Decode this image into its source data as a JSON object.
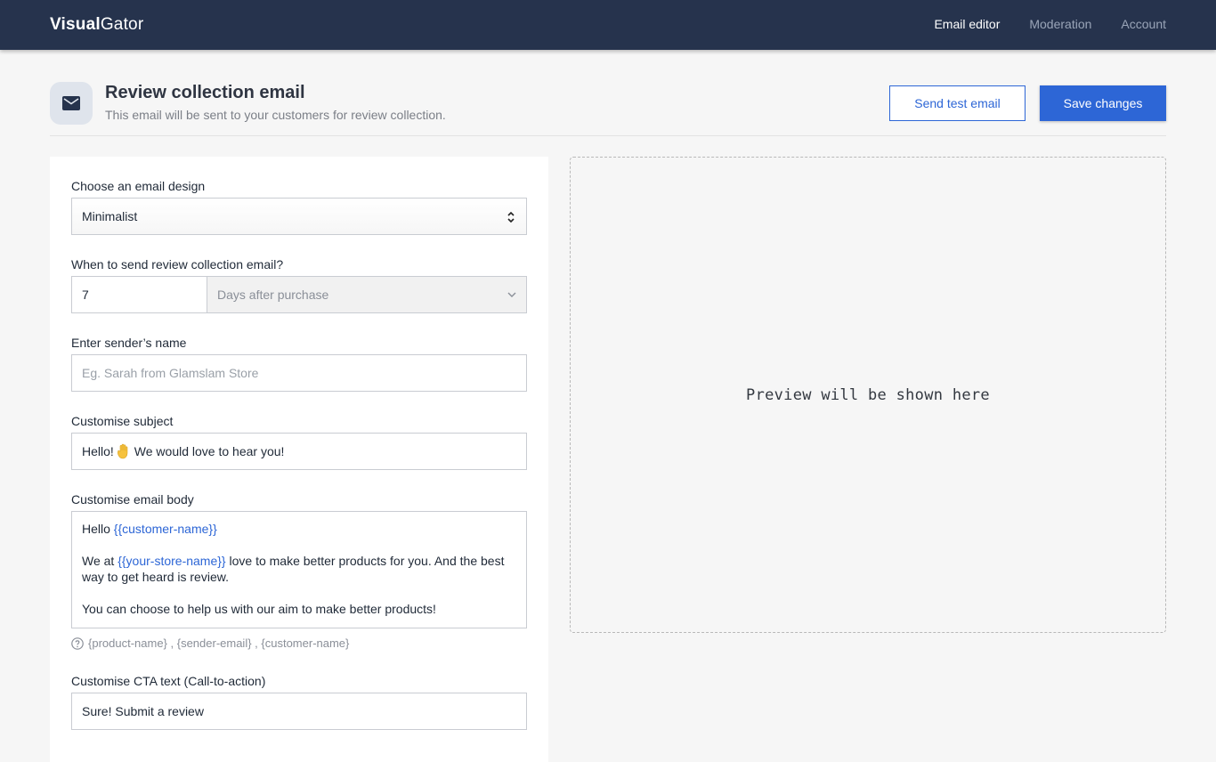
{
  "brand": {
    "bold": "Visual",
    "light": "Gator"
  },
  "nav": [
    {
      "label": "Email editor",
      "active": true
    },
    {
      "label": "Moderation",
      "active": false
    },
    {
      "label": "Account",
      "active": false
    }
  ],
  "header": {
    "title": "Review collection email",
    "subtitle": "This email will be sent to your customers for review collection.",
    "icon": "mail-icon",
    "send_test_label": "Send test email",
    "save_label": "Save changes"
  },
  "form": {
    "design": {
      "label": "Choose an email design",
      "value": "Minimalist"
    },
    "timing": {
      "label": "When to send review collection email?",
      "days": "7",
      "unit": "Days after purchase"
    },
    "sender": {
      "label": "Enter sender’s name",
      "placeholder": "Eg. Sarah from Glamslam Store",
      "value": ""
    },
    "subject": {
      "label": "Customise subject",
      "before": "Hello!",
      "emoji": "waving-hand-icon",
      "after": "We would love to hear you!"
    },
    "body": {
      "label": "Customise email body",
      "line1_prefix": "Hello ",
      "line1_token": "{{customer-name}}",
      "line2_prefix": "We at ",
      "line2_token": "{{your-store-name}}",
      "line2_suffix": " love to make better products for you. And the best way to get heard is review.",
      "line3": "You can choose to help us with our aim to make better products!"
    },
    "variables_hint": "{product-name} , {sender-email} , {customer-name}",
    "cta": {
      "label": "Customise CTA text (Call-to-action)",
      "value": "Sure! Submit a review"
    }
  },
  "preview": {
    "text": "Preview will be shown here"
  },
  "colors": {
    "navbar": "#26334d",
    "accent": "#2d66d6",
    "background": "#f6f6f6"
  }
}
